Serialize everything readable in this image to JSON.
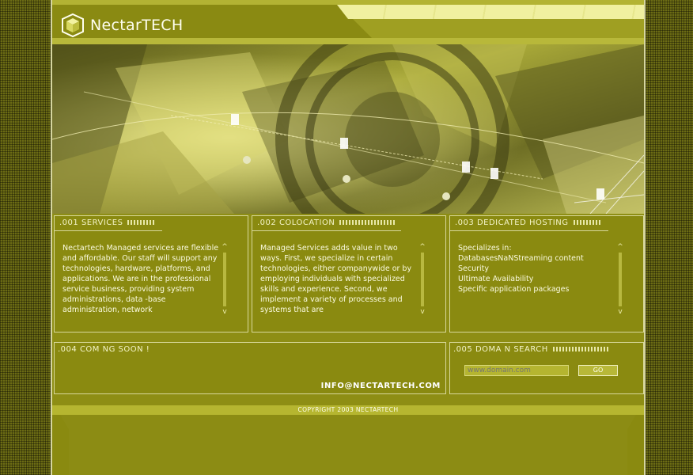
{
  "brand": {
    "name": "NectarTECH",
    "logo_icon": "cube-icon"
  },
  "panels": [
    {
      "tab": ".001 SERVICES",
      "text": "Nectartech Managed services are flexible and affordable. Our staff will support any technologies, hardware, platforms, and applications. We are in the professional service business, providing system administrations, data -base administration, network",
      "scroll_up": "^",
      "scroll_down": "v"
    },
    {
      "tab": ".002 COLOCATION",
      "text": "Managed Services adds value in two ways. First, we specialize in certain technologies, either companywide or by employing individuals with specialized skills and experience. Second, we implement a variety of processes and systems that are",
      "scroll_up": "^",
      "scroll_down": "v"
    },
    {
      "tab": ".003 DEDICATED HOSTING",
      "lines": [
        "Specializes in:",
        "DatabasesNaNStreaming content",
        "Security",
        "Ultimate Availability",
        "Specific application packages"
      ],
      "scroll_up": "^",
      "scroll_down": "v"
    }
  ],
  "coming_soon": {
    "tab": ".004 COM NG SOON !",
    "email": "INFO@NECTARTECH.COM"
  },
  "domain_search": {
    "tab": ".005 DOMA N SEARCH",
    "placeholder": "www.domain.com",
    "button": "GO"
  },
  "footer": {
    "copyright": "COPYRIGHT 2003 NECTARTECH"
  },
  "colors": {
    "background": "#6b6b14",
    "panel": "#8a8a10",
    "accent": "#f0f0a0",
    "border": "#d8d89a"
  }
}
